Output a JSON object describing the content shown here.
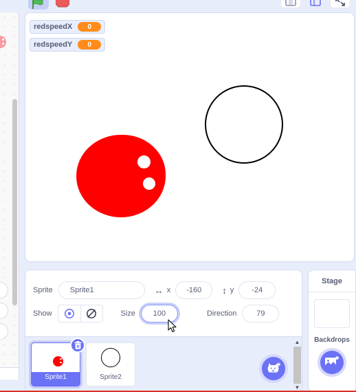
{
  "toolbar": {
    "green_flag": "green-flag",
    "stop": "stop-sign",
    "layout_small": "small-stage-layout",
    "layout_large": "large-stage-layout",
    "layout_full": "fullscreen"
  },
  "stage": {
    "monitors": [
      {
        "label": "redspeedX",
        "value": "0"
      },
      {
        "label": "redspeedY",
        "value": "0"
      }
    ],
    "sprites_on_stage": [
      {
        "name": "red-blob",
        "color": "#ff0000"
      },
      {
        "name": "black-outline-circle",
        "color": "#000000"
      }
    ]
  },
  "sprite_info": {
    "sprite_label": "Sprite",
    "sprite_name": "Sprite1",
    "x_label": "x",
    "x_value": "-160",
    "y_label": "y",
    "y_value": "-24",
    "show_label": "Show",
    "size_label": "Size",
    "size_value": "100",
    "direction_label": "Direction",
    "direction_value": "79"
  },
  "sprite_list": {
    "items": [
      {
        "name": "Sprite1",
        "selected": true
      },
      {
        "name": "Sprite2",
        "selected": false
      }
    ],
    "add_sprite": "add-sprite"
  },
  "stage_selector": {
    "title": "Stage",
    "backdrops_label": "Backdrops",
    "add_backdrop": "add-backdrop"
  },
  "colors": {
    "accent": "#6b72f5",
    "panel_bg": "#e8edfb",
    "monitor_value": "#ff8c1a",
    "sprite_red": "#ff0000"
  }
}
